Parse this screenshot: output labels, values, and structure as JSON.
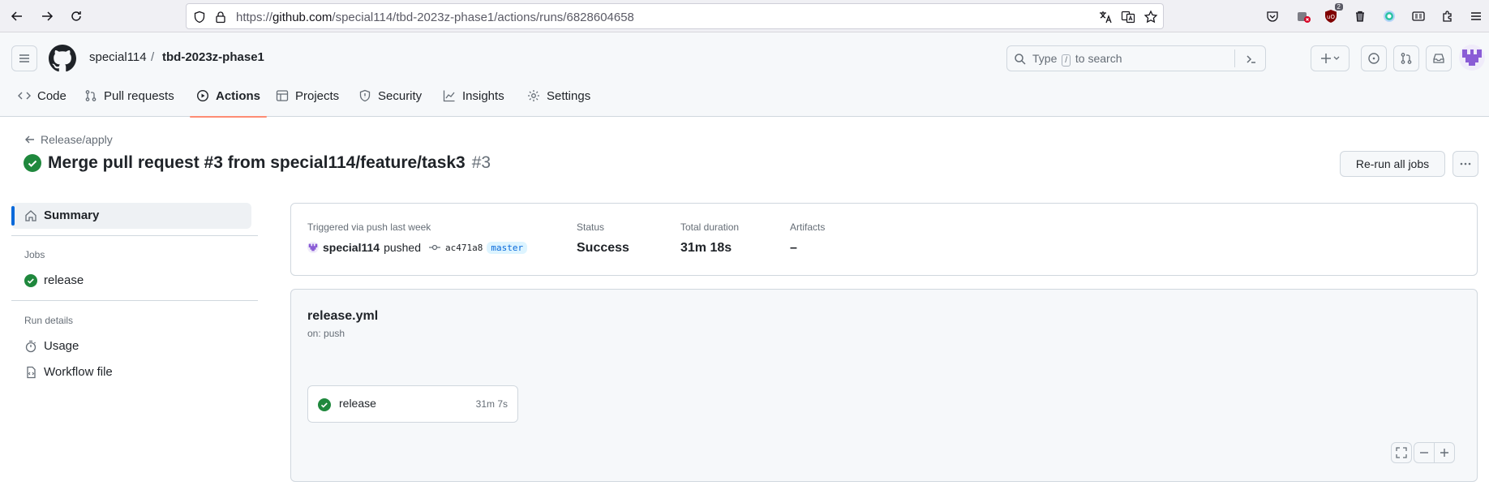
{
  "browser": {
    "url_scheme": "https://",
    "url_host": "github.com",
    "url_path": "/special114/tbd-2023z-phase1/actions/runs/6828604658",
    "ublock_badge": "2"
  },
  "header": {
    "owner": "special114",
    "separator": "/",
    "repo": "tbd-2023z-phase1",
    "search_placeholder_pre": "Type",
    "search_slash": "/",
    "search_placeholder_post": "to search"
  },
  "repo_tabs": [
    {
      "label": "Code",
      "active": false
    },
    {
      "label": "Pull requests",
      "active": false
    },
    {
      "label": "Actions",
      "active": true
    },
    {
      "label": "Projects",
      "active": false
    },
    {
      "label": "Security",
      "active": false
    },
    {
      "label": "Insights",
      "active": false
    },
    {
      "label": "Settings",
      "active": false
    }
  ],
  "run": {
    "back_label": "Release/apply",
    "title": "Merge pull request #3 from special114/feature/task3",
    "number": "#3",
    "rerun_label": "Re-run all jobs"
  },
  "sidebar": {
    "summary_label": "Summary",
    "jobs_heading": "Jobs",
    "jobs": [
      {
        "label": "release"
      }
    ],
    "run_details_heading": "Run details",
    "details": [
      {
        "label": "Usage"
      },
      {
        "label": "Workflow file"
      }
    ]
  },
  "summary": {
    "trigger_label": "Triggered via push last week",
    "actor": "special114",
    "action": "pushed",
    "sha": "ac471a8",
    "branch": "master",
    "status_label": "Status",
    "status_value": "Success",
    "duration_label": "Total duration",
    "duration_value": "31m 18s",
    "artifacts_label": "Artifacts",
    "artifacts_value": "–"
  },
  "workflow": {
    "file": "release.yml",
    "on": "on: push",
    "job_name": "release",
    "job_duration": "31m 7s"
  },
  "colors": {
    "success": "#1f883d",
    "accent_underline": "#fd8c73",
    "link_blue": "#0969da"
  }
}
